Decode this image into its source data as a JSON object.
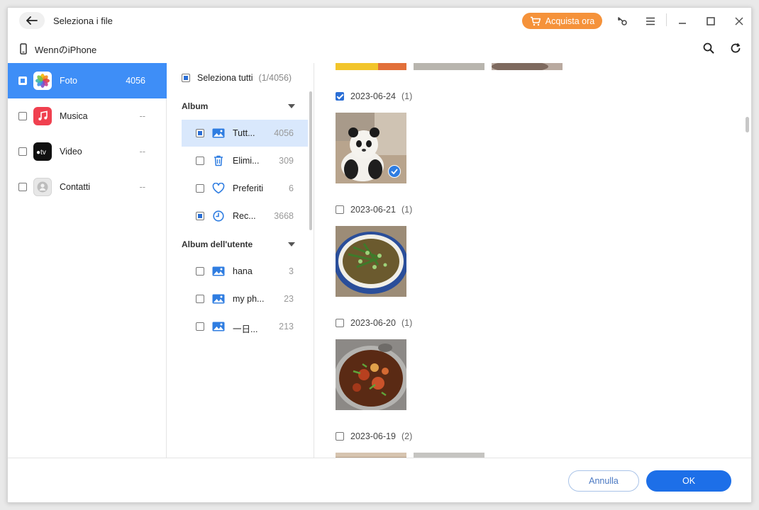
{
  "window": {
    "title": "Seleziona i file",
    "buy_label": "Acquista ora",
    "device_name": "WennのiPhone"
  },
  "colors": {
    "accent": "#3e8ef7",
    "buy": "#f5923a",
    "ok": "#1d6fe8"
  },
  "categories": [
    {
      "label": "Foto",
      "count": "4056",
      "icon": "photos-app-icon",
      "active": true
    },
    {
      "label": "Musica",
      "count": "--",
      "icon": "music-app-icon"
    },
    {
      "label": "Video",
      "count": "--",
      "icon": "tv-app-icon"
    },
    {
      "label": "Contatti",
      "count": "--",
      "icon": "contacts-app-icon"
    }
  ],
  "albums_panel": {
    "select_all_label": "Seleziona tutti",
    "select_all_count": "(1/4056)",
    "album_header": "Album",
    "albums": [
      {
        "name": "Tutt...",
        "count": "4056",
        "icon": "image-album-icon"
      },
      {
        "name": "Elimi...",
        "count": "309",
        "icon": "trash-icon"
      },
      {
        "name": "Preferiti",
        "count": "6",
        "icon": "heart-icon"
      },
      {
        "name": "Rec...",
        "count": "3668",
        "icon": "clock-icon"
      }
    ],
    "user_album_header": "Album dell'utente",
    "user_albums": [
      {
        "name": "hana",
        "count": "3",
        "icon": "image-album-icon"
      },
      {
        "name": "my ph...",
        "count": "23",
        "icon": "image-album-icon"
      },
      {
        "name": "一日...",
        "count": "213",
        "icon": "image-album-icon"
      }
    ]
  },
  "photo_groups": [
    {
      "date": "2023-06-24",
      "count": "(1)",
      "checked": true
    },
    {
      "date": "2023-06-21",
      "count": "(1)"
    },
    {
      "date": "2023-06-20",
      "count": "(1)"
    },
    {
      "date": "2023-06-19",
      "count": "(2)"
    }
  ],
  "footer": {
    "cancel_label": "Annulla",
    "ok_label": "OK"
  }
}
